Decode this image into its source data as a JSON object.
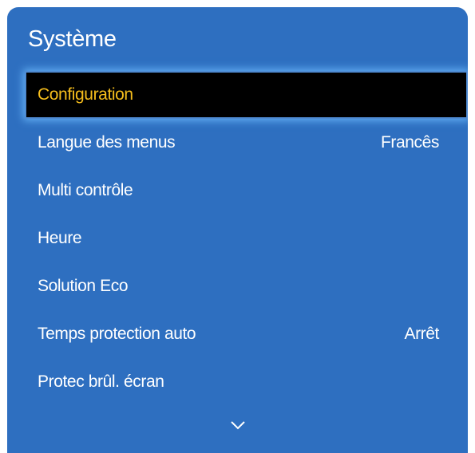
{
  "panel": {
    "title": "Système"
  },
  "menu": {
    "items": [
      {
        "label": "Configuration",
        "value": "",
        "selected": true
      },
      {
        "label": "Langue des menus",
        "value": "Francês"
      },
      {
        "label": "Multi contrôle",
        "value": ""
      },
      {
        "label": "Heure",
        "value": ""
      },
      {
        "label": "Solution Eco",
        "value": ""
      },
      {
        "label": "Temps protection auto",
        "value": "Arrêt"
      },
      {
        "label": "Protec brûl. écran",
        "value": ""
      }
    ]
  },
  "scroll": {
    "icon": "chevron-down-icon"
  },
  "colors": {
    "panel_background": "#2e6fc0",
    "selected_background": "#000000",
    "selected_text": "#f5bd1c",
    "text": "#ffffff"
  }
}
